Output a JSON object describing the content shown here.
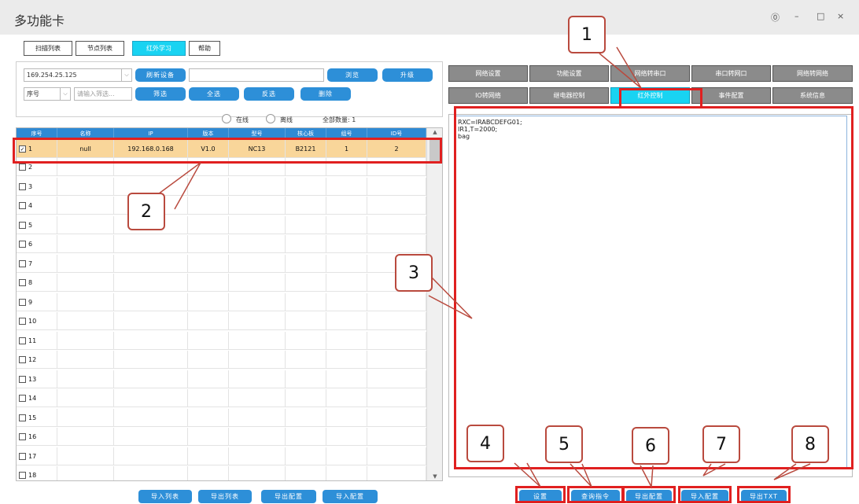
{
  "window": {
    "title": "多功能卡",
    "controls": [
      "⓪",
      "–",
      "□",
      "×"
    ]
  },
  "top_tabs": [
    "扫描列表",
    "节点列表",
    "红外学习",
    "帮助"
  ],
  "panel": {
    "ip_value": "169.254.25.125",
    "refresh_label": "刷新设备",
    "path_value": "",
    "browse_label": "浏览",
    "upgrade_label": "升级",
    "sort_value": "序号",
    "filter_placeholder": "请输入筛选...",
    "filter_label": "筛选",
    "select_all_label": "全选",
    "invert_label": "反选",
    "delete_label": "删除"
  },
  "status": {
    "online": "在线",
    "offline": "离线",
    "total": "全部数量: 1"
  },
  "table": {
    "headers": [
      "序号",
      "名称",
      "IP",
      "版本",
      "型号",
      "核心板",
      "组号",
      "ID号"
    ],
    "selected_row": [
      "1",
      "null",
      "192.168.0.168",
      "V1.0",
      "NC13",
      "B2121",
      "1",
      "2"
    ],
    "row_numbers": [
      "2",
      "3",
      "4",
      "5",
      "6",
      "7",
      "8",
      "9",
      "10",
      "11",
      "12",
      "13",
      "14",
      "15",
      "16",
      "17",
      "18"
    ]
  },
  "right_tabs_row1": [
    "网络设置",
    "功能设置",
    "网络转串口",
    "串口转网口",
    "网络转网络"
  ],
  "right_tabs_row2": [
    "IO转网络",
    "继电器控制",
    "红外控制",
    "事件配置",
    "系统信息"
  ],
  "command_text": "RXC=IRABCDEFG01;\nIR1,T=2000;\nbag",
  "left_bottom_buttons": [
    "导入列表",
    "导出列表",
    "导出配置",
    "导入配置"
  ],
  "right_bottom_buttons": [
    "设置",
    "查询指令",
    "导出配置",
    "导入配置",
    "导出TXT"
  ],
  "callouts": [
    "1",
    "2",
    "3",
    "4",
    "5",
    "6",
    "7",
    "8"
  ],
  "colors": {
    "accent": "#19d3f2",
    "button": "#2d8fd8",
    "header": "#2f8ad4",
    "selected_row": "#f9d69a",
    "highlight": "#e02020"
  }
}
